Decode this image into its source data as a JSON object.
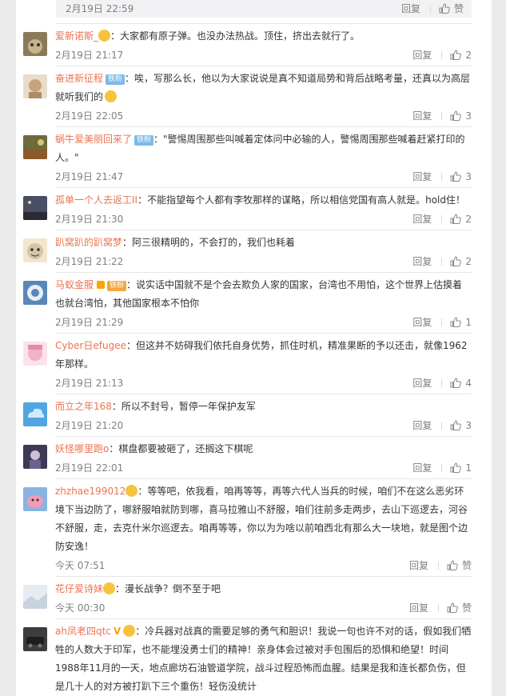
{
  "top_reply": {
    "date": "2月19日 22:59",
    "reply_label": "回复",
    "like_label": "赞"
  },
  "comments": [
    {
      "user": "爱新诺斯_",
      "emoji_after_name": true,
      "text": "：大家都有原子弹。也没办法热战。顶住，挤出去就行了。",
      "date": "2月19日 21:17",
      "reply": "回复",
      "likes": "2",
      "avatar_color": "#8a7a5c"
    },
    {
      "user": "奋进新征程",
      "badge": "铁粉",
      "text": "：唉，写那么长，他以为大家说说是真不知道局势和背后战略考量，还真以为高层就听我们的",
      "emoji_end": true,
      "date": "2月19日 22:05",
      "reply": "回复",
      "likes": "3",
      "avatar_color": "#c9a27e"
    },
    {
      "user": "蜗牛爱美丽回来了",
      "badge": "铁粉",
      "text": "：\"警惕周围那些叫喊着定体问中必输的人，警惕周围那些喊着赶紧打印的人。\"",
      "date": "2月19日 21:47",
      "reply": "回复",
      "likes": "3",
      "avatar_color": "#6d6a3c"
    },
    {
      "user": "孤单一个人去返工II",
      "text": "：不能指望每个人都有李牧那样的谋略，所以相信党国有高人就是。hold住！",
      "date": "2月19日 21:30",
      "reply": "回复",
      "likes": "2",
      "avatar_color": "#4a4f66"
    },
    {
      "user": "趴窝趴的趴窝梦",
      "text": "：阿三很精明的，不会打的，我们也耗着",
      "date": "2月19日 21:22",
      "reply": "回复",
      "likes": "2",
      "avatar_color": "#d7c4a4"
    },
    {
      "user": "马蚁金服",
      "badge": "铁粉",
      "badge_style": "gold",
      "emoji_after_name": true,
      "text": "：说实话中国就不是个会去欺负人家的国家，台湾也不用怕，这个世界上估摸着也就台湾怕，其他国家根本不怕你",
      "date": "2月19日 21:29",
      "reply": "回复",
      "likes": "1",
      "avatar_color": "#5b86b8"
    },
    {
      "user": "Cyber日efugee",
      "text": "：但这并不妨碍我们依托自身优势，抓住时机，精准果断的予以还击，就像1962年那样。",
      "date": "2月19日 21:13",
      "reply": "回复",
      "likes": "4",
      "avatar_color": "#f0b2c4"
    },
    {
      "user": "而立之年168",
      "text": "：所以不封号，暂停一年保护友军",
      "date": "2月19日 21:20",
      "reply": "回复",
      "likes": "3",
      "avatar_color": "#4fa6e0"
    },
    {
      "user": "妖怪哪里跑o",
      "text": "：棋盘都要被砸了，还搁这下棋呢",
      "date": "2月19日 22:01",
      "reply": "回复",
      "likes": "1",
      "avatar_color": "#3c3a55"
    },
    {
      "user": "zhzhae199012",
      "emoji_after_name": true,
      "text": "：等等吧，依我看，咱再等等，再等六代人当兵的时候，咱们不在这么恶劣环境下当边防了，哪舒服咱就防到哪，喜马拉雅山不舒服，咱们往前多走两步，去山下巡逻去，河谷不舒服，走，去克什米尔巡逻去。咱再等等，你以为为啥以前咱西北有那么大一块地，就是图个边防安逸！",
      "date": "今天 07:51",
      "reply": "回复",
      "likes": "赞",
      "avatar_color": "#8ab4e0"
    },
    {
      "user": "花仔爱诗妹",
      "emoji_after_name": true,
      "text": "：漫长战争？倒不至于吧",
      "date": "今天 00:30",
      "reply": "回复",
      "likes": "赞",
      "avatar_color": "#c8d3df"
    },
    {
      "user": "ah凤老四qtc",
      "verified": "V",
      "emoji_after_name": true,
      "text": "：冷兵器对战真的需要足够的勇气和胆识！我说一句也许不对的话，假如我们牺牲的人数大于印军，也不能埋没勇士们的精神！亲身体会过被对手包围后的恐惧和绝望！时间1988年11月的一天，地点廊坊石油管道学院，战斗过程恐怖而血腥。结果是我和连长都负伤，但是几十人的对方被打趴下三个重伤！轻伤没统计",
      "avatar_color": "#3d3d3d"
    }
  ]
}
